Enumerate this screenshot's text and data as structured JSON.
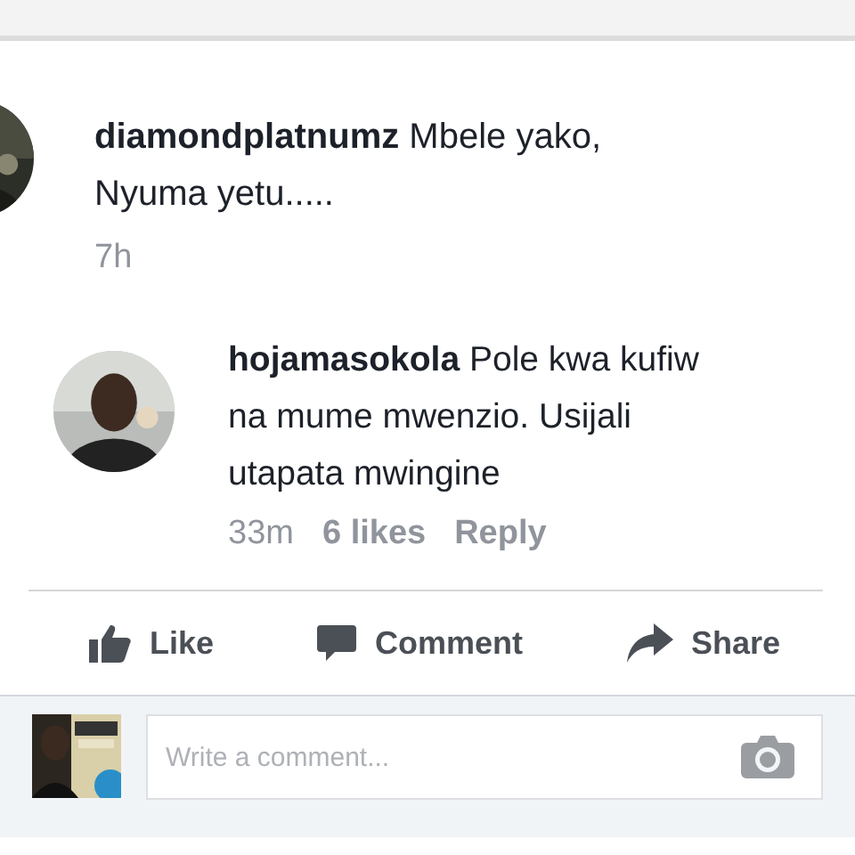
{
  "comments": [
    {
      "author": "diamondplatnumz",
      "text_lines": [
        "Mbele yako,",
        "Nyuma yetu....."
      ],
      "time": "7h",
      "reply": false
    },
    {
      "author": "hojamasokola",
      "text_lines": [
        "Pole kwa kufiw",
        "na mume mwenzio. Usijali",
        "utapata mwingine"
      ],
      "time": "33m",
      "likes": "6 likes",
      "reply_label": "Reply",
      "reply": true
    }
  ],
  "actions": [
    {
      "kind": "like",
      "label": "Like"
    },
    {
      "kind": "comment",
      "label": "Comment"
    },
    {
      "kind": "share",
      "label": "Share"
    }
  ],
  "composer": {
    "placeholder": "Write a comment..."
  }
}
